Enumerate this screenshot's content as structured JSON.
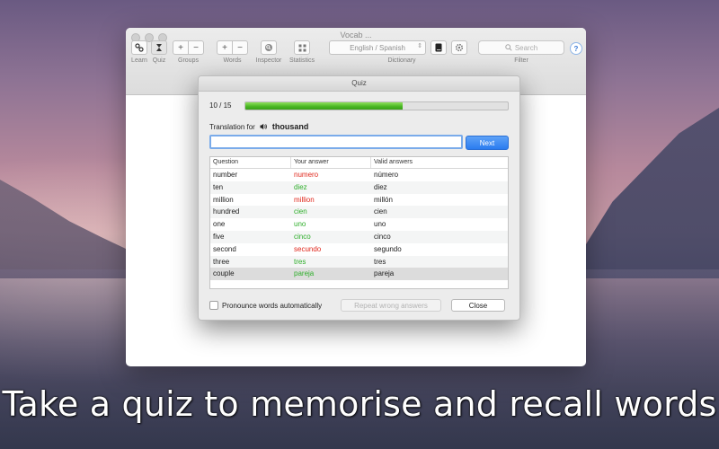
{
  "window": {
    "title": "Vocab ..."
  },
  "toolbar": {
    "learn_label": "Learn",
    "quiz_label": "Quiz",
    "groups_label": "Groups",
    "words_label": "Words",
    "inspector_label": "Inspector",
    "statistics_label": "Statistics",
    "dictionary_label": "Dictionary",
    "filter_label": "Filter",
    "plus": "+",
    "minus": "−",
    "dictionary_value": "English / Spanish",
    "search_placeholder": "Search",
    "help": "?"
  },
  "quiz": {
    "title": "Quiz",
    "progress_text": "10 / 15",
    "progress_fraction": 0.6,
    "translation_label": "Translation for",
    "word": "thousand",
    "answer_value": "",
    "next_label": "Next",
    "columns": [
      "Question",
      "Your answer",
      "Valid answers"
    ],
    "rows": [
      {
        "question": "number",
        "answer": "numero",
        "valid": "número",
        "correct": false
      },
      {
        "question": "ten",
        "answer": "diez",
        "valid": "diez",
        "correct": true
      },
      {
        "question": "million",
        "answer": "million",
        "valid": "millón",
        "correct": false
      },
      {
        "question": "hundred",
        "answer": "cien",
        "valid": "cien",
        "correct": true
      },
      {
        "question": "one",
        "answer": "uno",
        "valid": "uno",
        "correct": true
      },
      {
        "question": "five",
        "answer": "cinco",
        "valid": "cinco",
        "correct": true
      },
      {
        "question": "second",
        "answer": "secundo",
        "valid": "segundo",
        "correct": false
      },
      {
        "question": "three",
        "answer": "tres",
        "valid": "tres",
        "correct": true
      },
      {
        "question": "couple",
        "answer": "pareja",
        "valid": "pareja",
        "correct": true
      }
    ],
    "pronounce_label": "Pronounce words automatically",
    "pronounce_checked": false,
    "repeat_label": "Repeat wrong answers",
    "close_label": "Close"
  },
  "caption": "Take a quiz to memorise and recall words",
  "colors": {
    "wrong": "#e0261b",
    "correct": "#2eae2a",
    "accent": "#2b7cf0",
    "progress": "#47b521"
  }
}
